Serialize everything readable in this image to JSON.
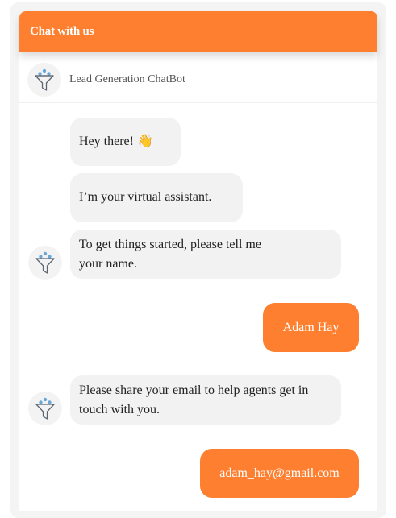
{
  "header": {
    "title": "Chat with us"
  },
  "bot": {
    "name": "Lead Generation ChatBot",
    "avatar_icon": "funnel-icon"
  },
  "colors": {
    "accent": "#fe7f2f",
    "bot_bubble": "#f2f2f2"
  },
  "messages": [
    {
      "sender": "bot",
      "text": "Hey there! 👋"
    },
    {
      "sender": "bot",
      "text": "I’m your virtual assistant."
    },
    {
      "sender": "bot",
      "text": "To get things started, please tell me your name."
    },
    {
      "sender": "user",
      "text": "Adam Hay"
    },
    {
      "sender": "bot",
      "text": "Please share your email to help agents get in touch with you."
    },
    {
      "sender": "user",
      "text": "adam_hay@gmail.com"
    }
  ]
}
